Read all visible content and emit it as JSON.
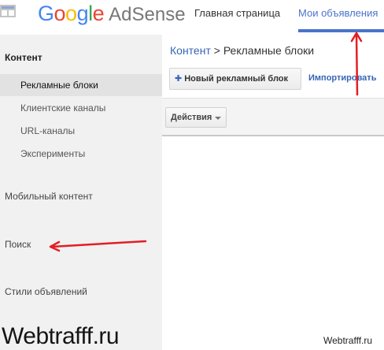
{
  "header": {
    "logo_google": [
      "G",
      "o",
      "o",
      "g",
      "l",
      "e"
    ],
    "logo_product": "AdSense",
    "nav_home": "Главная страница",
    "nav_my_ads": "Мои объявления"
  },
  "sidebar": {
    "section_title": "Контент",
    "items": [
      {
        "label": "Рекламные блоки",
        "active": true
      },
      {
        "label": "Клиентские каналы",
        "active": false
      },
      {
        "label": "URL-каналы",
        "active": false
      },
      {
        "label": "Эксперименты",
        "active": false
      }
    ],
    "mobile": "Мобильный контент",
    "search": "Поиск",
    "styles": "Стили объявлений"
  },
  "main": {
    "breadcrumb_link": "Контент",
    "breadcrumb_sep": " > ",
    "breadcrumb_current": "Рекламные блоки",
    "new_block_label": "Новый рекламный блок",
    "import_label": "Импортировать",
    "actions_label": "Действия"
  },
  "watermark": {
    "big": "Webtrafff.ru",
    "small": "Webtrafff.ru"
  },
  "colors": {
    "accent_blue": "#4a73cc",
    "arrow_red": "#e31e24",
    "sidebar_bg": "#f1f1f1"
  },
  "icons": [
    "apps-grid-icon",
    "plus-icon",
    "dropdown-caret-icon",
    "red-arrow-annotation"
  ]
}
